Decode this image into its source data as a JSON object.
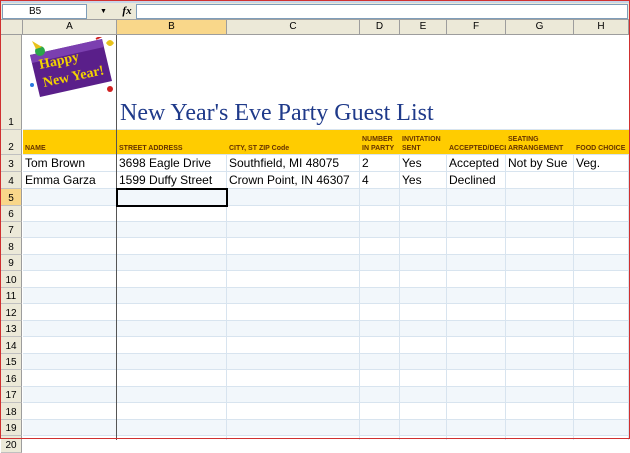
{
  "formula_bar": {
    "name_box": "B5",
    "fx_label": "fx",
    "formula_value": ""
  },
  "columns": [
    "A",
    "B",
    "C",
    "D",
    "E",
    "F",
    "G",
    "H"
  ],
  "rows": [
    "1",
    "2",
    "3",
    "4",
    "5",
    "6",
    "7",
    "8",
    "9",
    "10",
    "11",
    "12",
    "13",
    "14",
    "15",
    "16",
    "17",
    "18",
    "19",
    "20"
  ],
  "active_cell": {
    "column": "B",
    "row": "5"
  },
  "logo": {
    "line1": "Happy",
    "line2": "New Year!"
  },
  "sheet": {
    "title": "New Year's Eve Party Guest List",
    "headers": {
      "a": "NAME",
      "b": "STREET ADDRESS",
      "c": "CITY, ST  ZIP Code",
      "d": "NUMBER IN PARTY",
      "e": "INVITATION SENT",
      "f": "ACCEPTED/DECLINED",
      "g": "SEATING ARRANGEMENT",
      "h": "FOOD CHOICE"
    },
    "guests": [
      {
        "name": "Tom Brown",
        "street": "3698 Eagle Drive",
        "city": "Southfield, MI 48075",
        "number": "2",
        "invitation": "Yes",
        "status": "Accepted",
        "seating": "Not by Sue",
        "food": "Veg."
      },
      {
        "name": "Emma Garza",
        "street": "1599 Duffy Street",
        "city": "Crown Point, IN 46307",
        "number": "4",
        "invitation": "Yes",
        "status": "Declined",
        "seating": "",
        "food": ""
      }
    ]
  },
  "colors": {
    "header_band": "#ffcc00",
    "title_text": "#1f3a8a",
    "header_text": "#663300",
    "active_header": "#f9d78a"
  }
}
